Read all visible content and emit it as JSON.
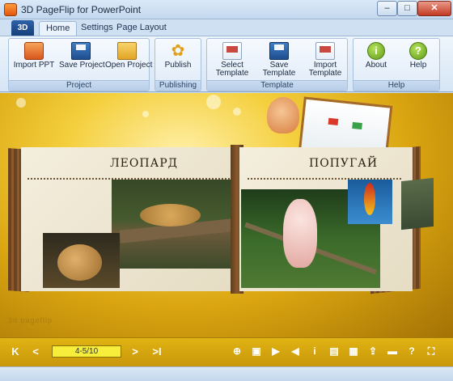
{
  "window": {
    "title": "3D PageFlip for PowerPoint",
    "controls": {
      "minimize": "–",
      "maximize": "□",
      "close": "✕"
    }
  },
  "ribbon": {
    "orb_label": "3D",
    "tabs": [
      {
        "label": "Home",
        "active": true
      },
      {
        "label": "Settings",
        "active": false
      },
      {
        "label": "Page Layout",
        "active": false
      }
    ],
    "groups": {
      "project": {
        "label": "Project",
        "buttons": {
          "import_ppt": "Import PPT",
          "save_project": "Save Project",
          "open_project": "Open Project"
        }
      },
      "publishing": {
        "label": "Publishing",
        "buttons": {
          "publish": "Publish"
        }
      },
      "template": {
        "label": "Template",
        "buttons": {
          "select_template": [
            "Select",
            "Template"
          ],
          "save_template": [
            "Save",
            "Template"
          ],
          "import_template": [
            "Import",
            "Template"
          ]
        }
      },
      "help": {
        "label": "Help",
        "buttons": {
          "about": "About",
          "help": "Help"
        },
        "icon_glyphs": {
          "about": "i",
          "help": "?"
        }
      }
    }
  },
  "book": {
    "left_page_title": "ЛЕОПАРД",
    "right_page_title": "ПОПУГАЙ",
    "caption": "3d pageflip"
  },
  "toolbar": {
    "page_indicator": "4-5/10",
    "nav_glyphs": {
      "first": "K",
      "prev": "<",
      "next": ">",
      "last": ">I"
    },
    "tool_glyphs": {
      "zoom": "⊕",
      "thumbnails": "▣",
      "play": "▶",
      "sound": "◀",
      "info": "i",
      "print": "▤",
      "grid": "▦",
      "share": "⇪",
      "download": "▬",
      "help": "?",
      "fullscreen": "⛶"
    }
  },
  "colors": {
    "accent_bar": "#d6a510",
    "ribbon_bg": "#e4eef9",
    "page_field": "#f7ee3c"
  }
}
